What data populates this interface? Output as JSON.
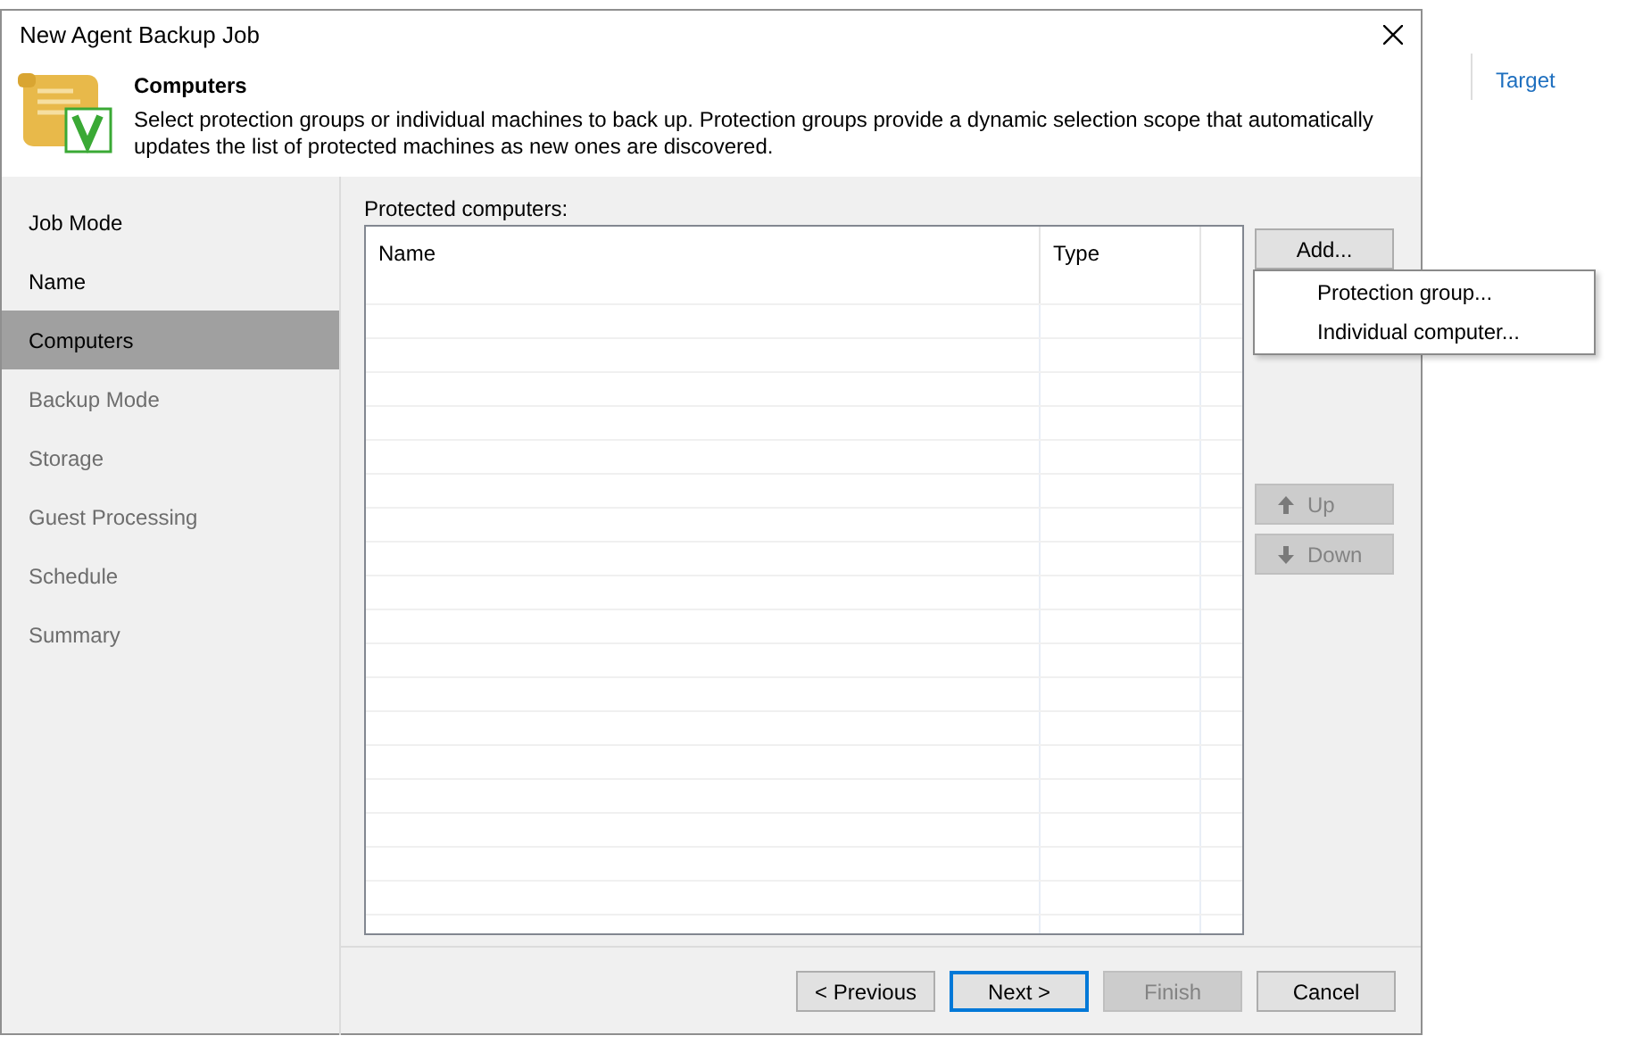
{
  "background": {
    "link": "Target"
  },
  "window": {
    "title": "New Agent Backup Job"
  },
  "header": {
    "title": "Computers",
    "description": "Select protection groups or individual machines to back up. Protection groups provide a dynamic selection scope that automatically updates the list of protected machines as new ones are discovered."
  },
  "steps": [
    {
      "label": "Job Mode",
      "selected": false,
      "disabled": false
    },
    {
      "label": "Name",
      "selected": false,
      "disabled": false
    },
    {
      "label": "Computers",
      "selected": true,
      "disabled": false
    },
    {
      "label": "Backup Mode",
      "selected": false,
      "disabled": true
    },
    {
      "label": "Storage",
      "selected": false,
      "disabled": true
    },
    {
      "label": "Guest Processing",
      "selected": false,
      "disabled": true
    },
    {
      "label": "Schedule",
      "selected": false,
      "disabled": true
    },
    {
      "label": "Summary",
      "selected": false,
      "disabled": true
    }
  ],
  "table": {
    "label": "Protected computers:",
    "columns": [
      "Name",
      "Type"
    ]
  },
  "side_buttons": [
    {
      "label": "Add...",
      "kind": "plain",
      "disabled": false
    },
    {
      "label": "Up",
      "kind": "up",
      "disabled": true
    },
    {
      "label": "Down",
      "kind": "down",
      "disabled": true
    }
  ],
  "add_menu": [
    "Protection group...",
    "Individual computer..."
  ],
  "footer_buttons": [
    {
      "label": "< Previous",
      "disabled": false,
      "focused": false
    },
    {
      "label": "Next >",
      "disabled": false,
      "focused": true
    },
    {
      "label": "Finish",
      "disabled": true,
      "focused": false
    },
    {
      "label": "Cancel",
      "disabled": false,
      "focused": false
    }
  ]
}
